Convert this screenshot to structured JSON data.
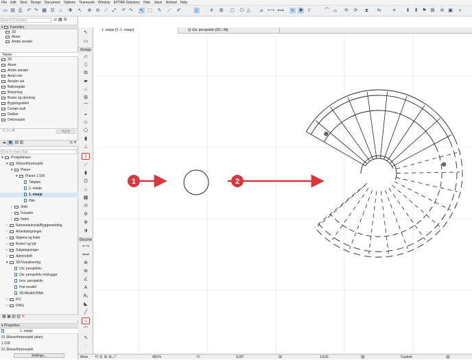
{
  "menu": [
    "File",
    "Edit",
    "View",
    "Design",
    "Document",
    "Options",
    "Teamwork",
    "Window",
    "EPTAR Solutions",
    "Help",
    "Jotun",
    "Norkart",
    "Help"
  ],
  "search": {
    "favorites_placeholder": "Search Favorites",
    "viewmap_placeholder": "Search View Map"
  },
  "favorites": {
    "header": "Favorites",
    "items": [
      "2D",
      "Akser",
      "Andre arealer"
    ]
  },
  "names": {
    "header": "Name",
    "items": [
      "2D",
      "Akser",
      "Andre arealer",
      "Areal rom",
      "Arealer ute",
      "Balkongdør",
      "Belysning",
      "Brann og rømning",
      "Bygningsdeler",
      "Curtain wall",
      "Dekker",
      "Dekorasjon"
    ]
  },
  "apply_label": "Apply",
  "viewmap": {
    "items": [
      {
        "label": "Prosjektnavn",
        "level": 0,
        "type": "folder"
      },
      {
        "label": "Skisse/forprosjekt",
        "level": 1,
        "type": "folder"
      },
      {
        "label": "Planer",
        "level": 2,
        "type": "folder"
      },
      {
        "label": "Planer 1:100",
        "level": 3,
        "type": "folder"
      },
      {
        "label": "Takplan",
        "level": 4,
        "type": "doc"
      },
      {
        "label": "2. etasje",
        "level": 4,
        "type": "doc"
      },
      {
        "label": "1. etasje",
        "level": 4,
        "type": "doc",
        "selected": true
      },
      {
        "label": "Høv",
        "level": 4,
        "type": "doc"
      },
      {
        "label": "Snitt",
        "level": 2,
        "type": "folder"
      },
      {
        "label": "Fasader",
        "level": 2,
        "type": "folder"
      },
      {
        "label": "Index",
        "level": 2,
        "type": "folder"
      },
      {
        "label": "Rammetekniskt/Byggemelding",
        "level": 1,
        "type": "folder"
      },
      {
        "label": "Arbeidstegninger",
        "level": 1,
        "type": "folder"
      },
      {
        "label": "Skjema og lister",
        "level": 1,
        "type": "folder"
      },
      {
        "label": "Brann/ og lyd",
        "level": 1,
        "type": "folder"
      },
      {
        "label": "Salgstegninger",
        "level": 1,
        "type": "folder"
      },
      {
        "label": "Admin/drift",
        "level": 1,
        "type": "folder"
      },
      {
        "label": "3D/Visualisering",
        "level": 1,
        "type": "folder"
      },
      {
        "label": "Utv. perspektiv",
        "level": 2,
        "type": "doc"
      },
      {
        "label": "Utv. perspektiv m/skygge",
        "level": 2,
        "type": "doc"
      },
      {
        "label": "Innv. perspektiv",
        "level": 2,
        "type": "doc"
      },
      {
        "label": "Hvit modell",
        "level": 2,
        "type": "doc"
      },
      {
        "label": "3D-Modell BIMx",
        "level": 2,
        "type": "doc"
      },
      {
        "label": "IFC",
        "level": 1,
        "type": "folder"
      },
      {
        "label": "DWG",
        "level": 1,
        "type": "folder"
      }
    ]
  },
  "properties": {
    "header": "Properties",
    "current": "1. etasje",
    "lines": [
      "01 Skisse/forprosjekt (plan)",
      "1:100",
      "01 Skisse/forprosjekt"
    ],
    "settings_label": "Settings..."
  },
  "toolbox": {
    "design_label": "Design",
    "document_label": "Docume",
    "more_label": "More"
  },
  "tabs": [
    {
      "label": "1. etasje [2. 1. etasje]"
    },
    {
      "label": "(i) Utv. perspektiv [3D / All]"
    }
  ],
  "status": {
    "zoom": "491%",
    "angle": "0,00°",
    "scale": "1/100",
    "layer_combo": "Custom"
  },
  "annotations": [
    {
      "label": "1"
    },
    {
      "label": "2"
    }
  ],
  "colors": {
    "accent": "#d9363e",
    "highlight": "#e0312e",
    "selected": "#d7e6f8"
  }
}
